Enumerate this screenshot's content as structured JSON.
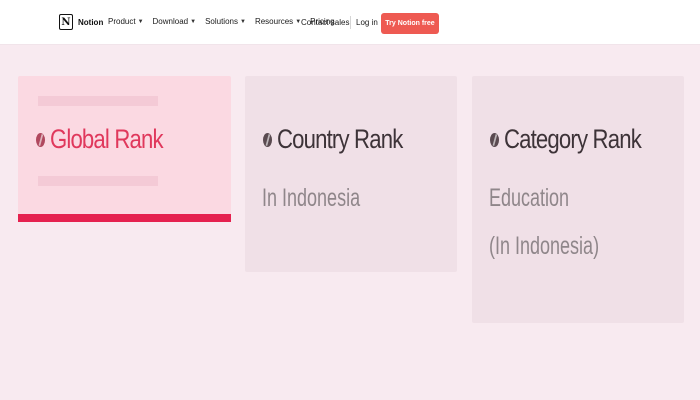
{
  "header": {
    "brand": "Notion",
    "logo_letter": "N",
    "nav": [
      {
        "label": "Product",
        "has_menu": true
      },
      {
        "label": "Download",
        "has_menu": true
      },
      {
        "label": "Solutions",
        "has_menu": true
      },
      {
        "label": "Resources",
        "has_menu": true
      },
      {
        "label": "Pricing",
        "has_menu": false
      }
    ],
    "contact_label": "Contact sales",
    "login_label": "Log in",
    "cta_label": "Try Notion free",
    "cta_color": "#ee5a52"
  },
  "cards": {
    "global": {
      "title": "Global Rank",
      "accent_color": "#e5214f"
    },
    "country": {
      "title": "Country Rank",
      "subtitle": "In Indonesia"
    },
    "category": {
      "title": "Category Rank",
      "subtitle_line1": "Education",
      "subtitle_line2": "(In Indonesia)"
    }
  }
}
